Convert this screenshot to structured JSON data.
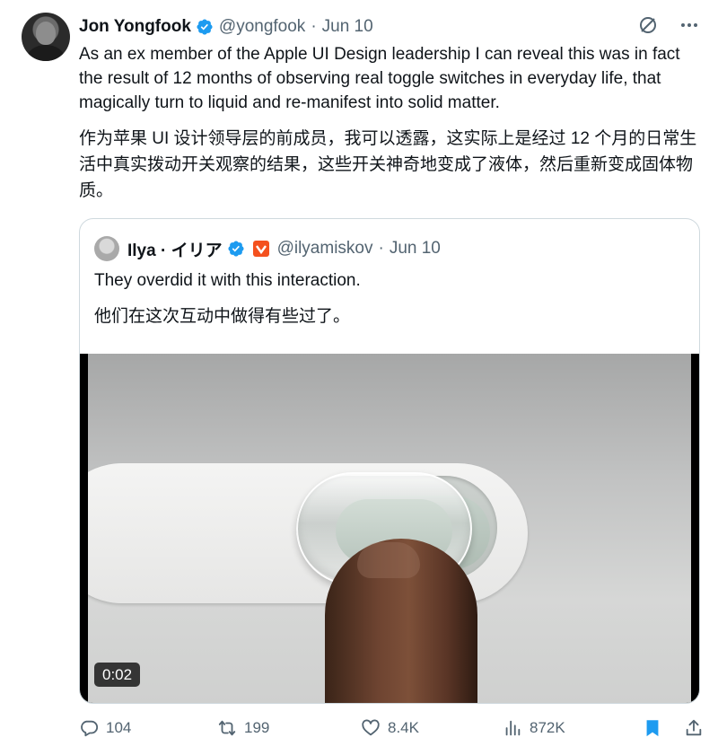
{
  "tweet": {
    "author": {
      "name": "Jon Yongfook",
      "handle": "@yongfook",
      "date": "Jun 10",
      "separator": "·"
    },
    "text_en": "As an ex member of the Apple UI Design leadership I can reveal this was in fact the result of 12 months of observing real toggle switches in everyday life, that magically turn to liquid and re-manifest into solid matter.",
    "text_zh": "作为苹果 UI 设计领导层的前成员，我可以透露，这实际上是经过 12 个月的日常生活中真实拨动开关观察的结果，这些开关神奇地变成了液体，然后重新变成固体物质。",
    "top_icons": [
      "grok-icon",
      "more-icon"
    ]
  },
  "quote": {
    "author": {
      "name": "Ilya · イリア",
      "handle": "@ilyamiskov",
      "date": "Jun 10",
      "separator": "·"
    },
    "text_en": "They overdid it with this interaction.",
    "text_zh": "他们在这次互动中做得有些过了。",
    "media": {
      "duration": "0:02"
    }
  },
  "actions": {
    "replies": "104",
    "reposts": "199",
    "likes": "8.4K",
    "views": "872K"
  },
  "colors": {
    "verified": "#1d9bf0",
    "bookmark": "#1d9bf0",
    "secondary_text": "#536471",
    "badge": "#f4511e"
  }
}
